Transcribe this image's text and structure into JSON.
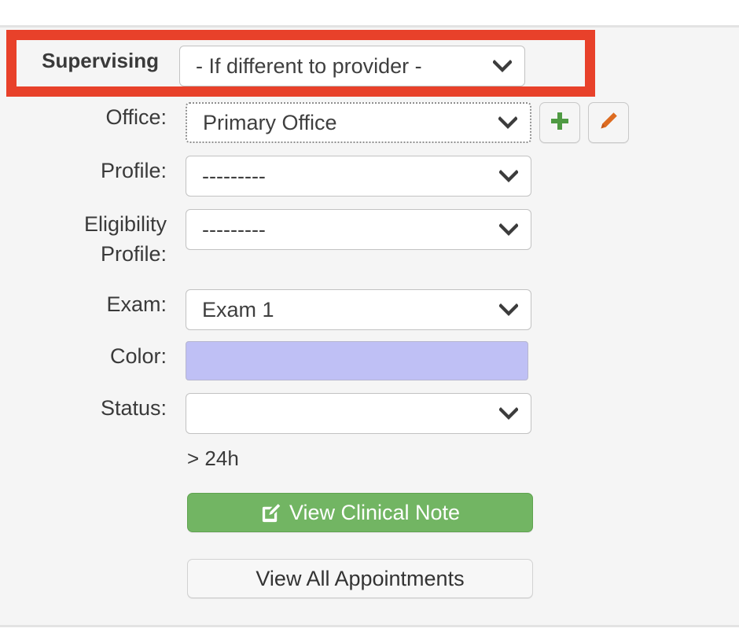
{
  "panel": {
    "background_color": "#f5f5f5",
    "highlight_color": "#e8412a"
  },
  "form": {
    "rows": [
      {
        "label": "Supervising",
        "control": "select",
        "value": "- If different to provider -",
        "highlighted": true,
        "bold_label": true
      },
      {
        "label": "Office:",
        "control": "select",
        "value": "Primary Office",
        "focused": true,
        "actions": [
          "add-icon",
          "edit-icon"
        ]
      },
      {
        "label": "Profile:",
        "control": "select",
        "value": "---------"
      },
      {
        "label": "Eligibility Profile:",
        "label_line1": "Eligibility",
        "label_line2": "Profile:",
        "control": "select",
        "value": "---------"
      },
      {
        "label": "Exam:",
        "control": "select",
        "value": "Exam 1"
      },
      {
        "label": "Color:",
        "control": "color-swatch",
        "value": "#bfc0f5"
      },
      {
        "label": "Status:",
        "control": "select",
        "value": ""
      }
    ]
  },
  "icons": {
    "add": "plus-icon",
    "edit": "pencil-icon",
    "chevron": "chevron-down-icon",
    "clinical_note": "pencil-square-icon"
  },
  "icon_colors": {
    "add": "#4f9a43",
    "edit": "#dd6b20",
    "chevron": "#3c3c3c"
  },
  "note": {
    "duration_text": "> 24h"
  },
  "buttons": {
    "view_clinical_note": "View Clinical Note",
    "view_clinical_note_color": "#72b563",
    "view_all_appointments": "View All Appointments"
  }
}
